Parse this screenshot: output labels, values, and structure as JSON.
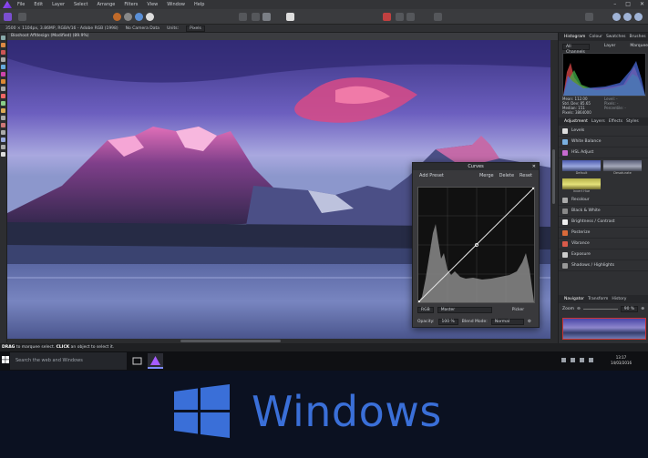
{
  "menubar": {
    "items": [
      "File",
      "Edit",
      "Layer",
      "Select",
      "Arrange",
      "Filters",
      "View",
      "Window",
      "Help"
    ]
  },
  "context_bar": {
    "image_info": "3500 × 1104px, 3.86MP, RGBA/16 - Adobe RGB (1998)",
    "camera": "No Camera Data",
    "units_label": "Units:",
    "units_value": "Pixels"
  },
  "document": {
    "tab_title": "Bioshoot Affdesign (Modified) (89.9%)"
  },
  "curves_dialog": {
    "title": "Curves",
    "add_preset": "Add Preset",
    "merge": "Merge",
    "delete": "Delete",
    "reset": "Reset",
    "channel_mode": "RGB",
    "channel": "Master",
    "picker": "Picker",
    "opacity_label": "Opacity:",
    "opacity_value": "100 %",
    "blend_label": "Blend Mode:",
    "blend_value": "Normal"
  },
  "histogram_panel": {
    "tabs": [
      "Histogram",
      "Colour",
      "Swatches",
      "Brushes"
    ],
    "channel": "All Channels",
    "layer_label": "Layer",
    "marquee_label": "Marquee",
    "stats": [
      "Mean: 112.00",
      "Std. Dev: 85.65",
      "Median: 151",
      "Pixels: 3864000"
    ],
    "stats_right": [
      "Level: -",
      "Pixels: -",
      "Percentile: -"
    ]
  },
  "adjustment_panel": {
    "tabs": [
      "Adjustment",
      "Layers",
      "Effects",
      "Styles"
    ],
    "items": [
      "Levels",
      "White Balance",
      "HSL Adjust",
      "Recolour",
      "Black & White",
      "Brightness / Contrast",
      "Posterize",
      "Vibrance",
      "Exposure",
      "Shadows / Highlights"
    ],
    "presets_row1": [
      "Default",
      "Desaturate"
    ],
    "presets_row2": [
      "Invert Hue"
    ]
  },
  "navigator_panel": {
    "tabs": [
      "Navigator",
      "Transform",
      "History"
    ],
    "zoom_label": "Zoom",
    "zoom_value": "90 %"
  },
  "status": {
    "hint_drag": "DRAG",
    "hint_mid": " to marquee select. ",
    "hint_click": "CLICK",
    "hint_end": " an object to select it."
  },
  "taskbar": {
    "search_placeholder": "Search the web and Windows",
    "time": "13:17",
    "date": "14/03/2016"
  },
  "banner": {
    "text": "Windows",
    "brand_color": "#3a6fd8"
  }
}
